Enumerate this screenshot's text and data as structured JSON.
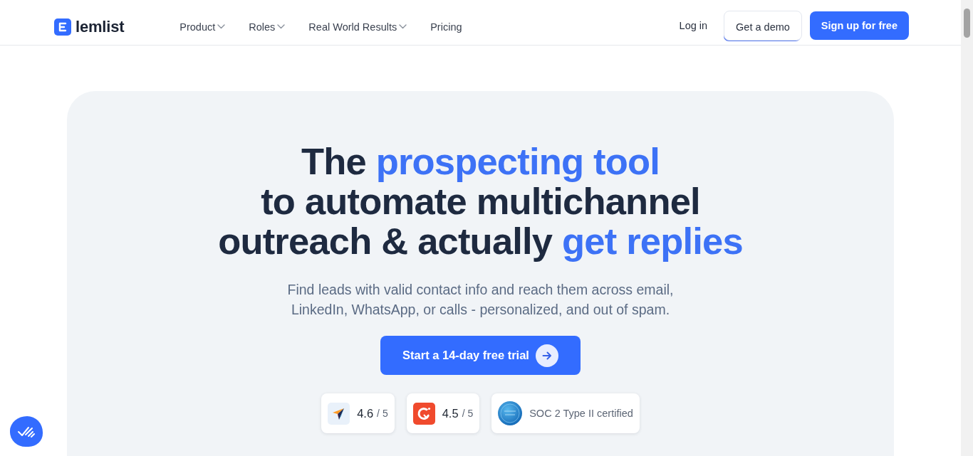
{
  "header": {
    "logo": {
      "text": "lemlist"
    },
    "nav": [
      {
        "label": "Product",
        "has_menu": true
      },
      {
        "label": "Roles",
        "has_menu": true
      },
      {
        "label": "Real World Results",
        "has_menu": true
      },
      {
        "label": "Pricing",
        "has_menu": false
      }
    ],
    "login": "Log in",
    "demo_button": "Get a demo",
    "signup_button": "Sign up for free"
  },
  "hero": {
    "headline": [
      [
        {
          "text": "The ",
          "highlight": false
        },
        {
          "text": "prospecting tool",
          "highlight": true
        }
      ],
      [
        {
          "text": "to automate multichannel",
          "highlight": false
        }
      ],
      [
        {
          "text": "outreach & actually ",
          "highlight": false
        },
        {
          "text": "get replies",
          "highlight": true
        }
      ]
    ],
    "subtitle_lines": [
      "Find leads with valid contact info and reach them across email,",
      "LinkedIn, WhatsApp, or calls - personalized, and out of spam."
    ],
    "cta": "Start a 14-day free trial",
    "badges": [
      {
        "kind": "rating",
        "logo": {
          "kind": "arrow"
        },
        "score": "4.6",
        "scale": "/ 5"
      },
      {
        "kind": "rating",
        "logo": {
          "kind": "tile"
        },
        "score": "4.5",
        "scale": "/ 5"
      },
      {
        "kind": "certification",
        "logo": {
          "kind": "seal"
        },
        "label": "SOC 2 Type II certified"
      }
    ]
  }
}
